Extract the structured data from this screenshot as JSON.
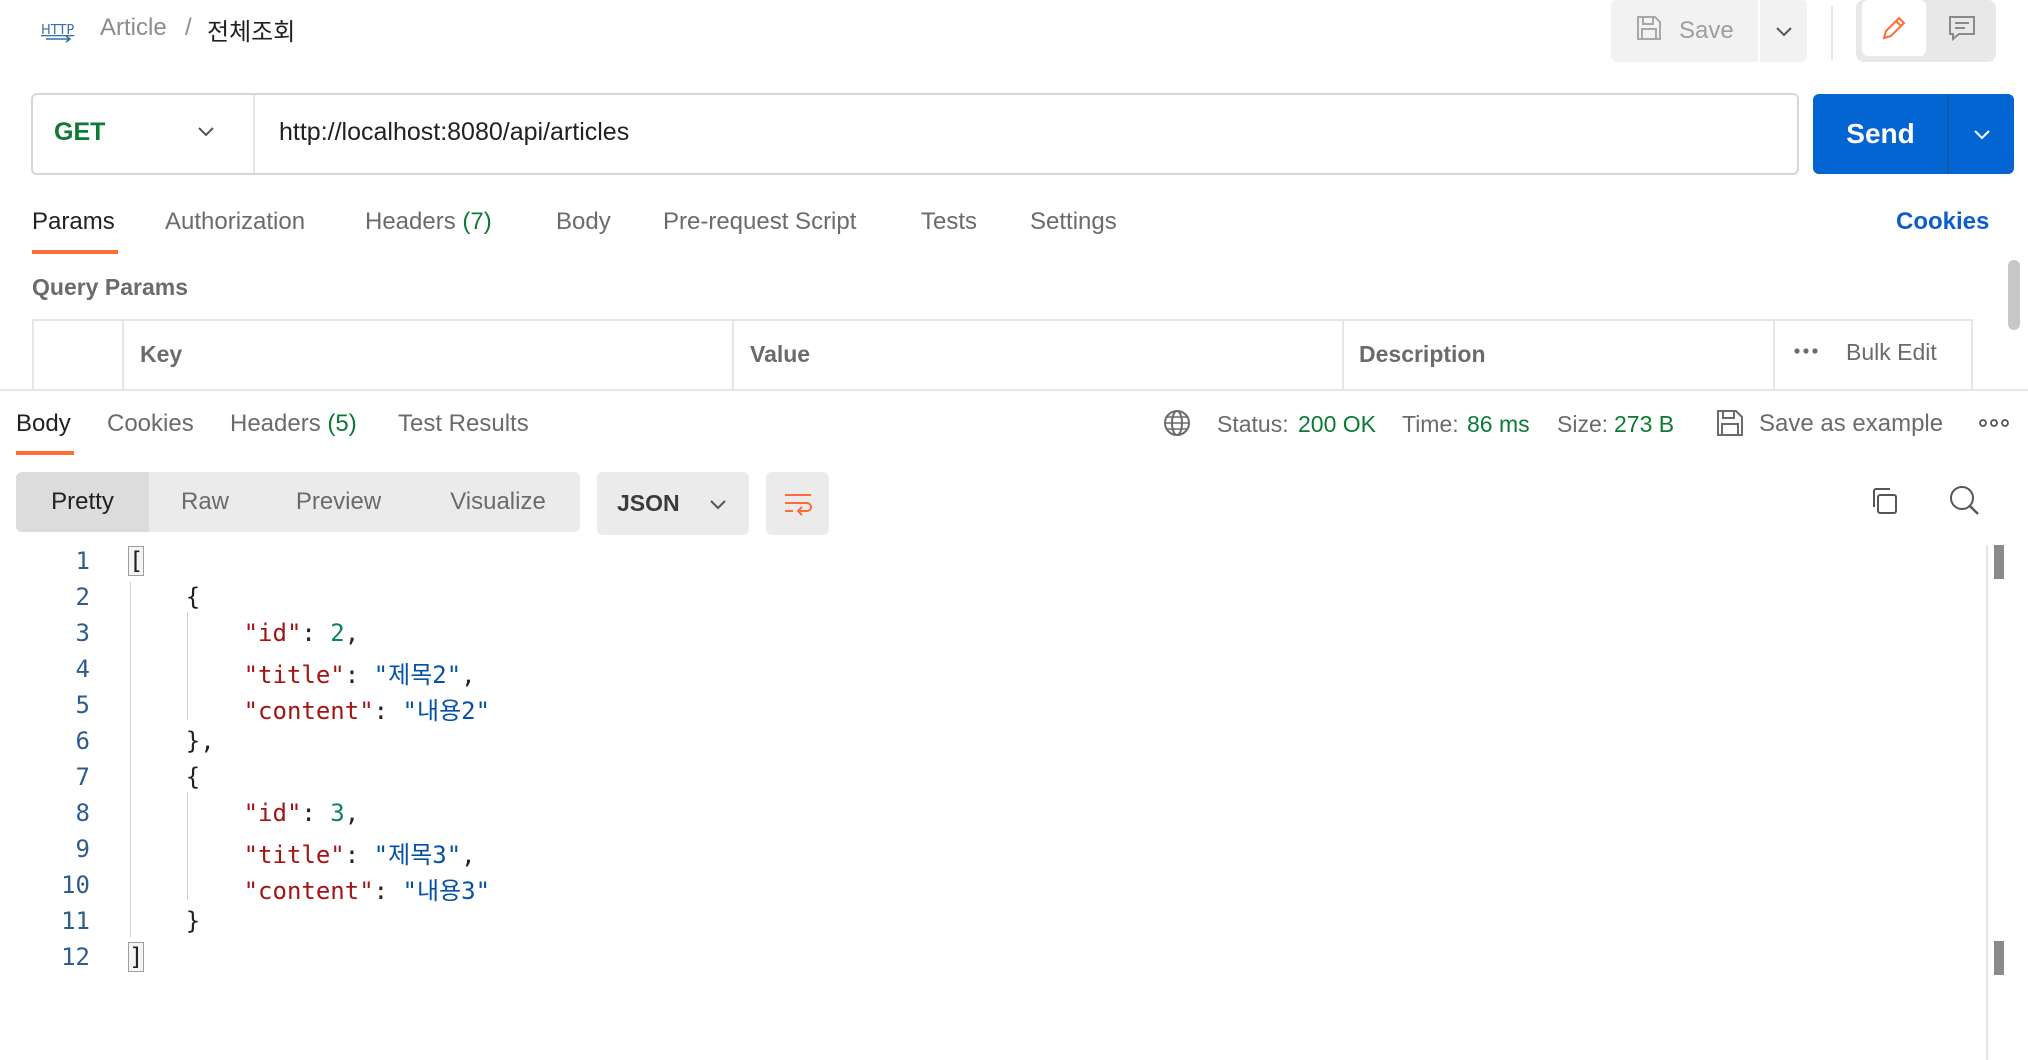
{
  "breadcrumb": {
    "icon": "http-icon",
    "parent": "Article",
    "separator": "/",
    "current": "전체조회"
  },
  "toolbar": {
    "save_label": "Save"
  },
  "request": {
    "method": "GET",
    "url": "http://localhost:8080/api/articles",
    "send_label": "Send",
    "tabs": [
      {
        "label": "Params",
        "active": true
      },
      {
        "label": "Authorization"
      },
      {
        "label": "Headers",
        "count": "(7)"
      },
      {
        "label": "Body"
      },
      {
        "label": "Pre-request Script"
      },
      {
        "label": "Tests"
      },
      {
        "label": "Settings"
      }
    ],
    "cookies_label": "Cookies",
    "query_params": {
      "title": "Query Params",
      "columns": [
        "Key",
        "Value",
        "Description"
      ],
      "bulk_edit_label": "Bulk Edit"
    }
  },
  "response": {
    "tabs": [
      {
        "label": "Body",
        "active": true
      },
      {
        "label": "Cookies"
      },
      {
        "label": "Headers",
        "count": "(5)"
      },
      {
        "label": "Test Results"
      }
    ],
    "status_label": "Status:",
    "status_value": "200 OK",
    "time_label": "Time:",
    "time_value": "86 ms",
    "size_label": "Size:",
    "size_value": "273 B",
    "save_example_label": "Save as example",
    "views": [
      "Pretty",
      "Raw",
      "Preview",
      "Visualize"
    ],
    "active_view": "Pretty",
    "format": "JSON",
    "line_numbers": [
      "1",
      "2",
      "3",
      "4",
      "5",
      "6",
      "7",
      "8",
      "9",
      "10",
      "11",
      "12"
    ],
    "body": [
      {
        "id": 2,
        "title": "제목2",
        "content": "내용2"
      },
      {
        "id": 3,
        "title": "제목3",
        "content": "내용3"
      }
    ]
  },
  "colors": {
    "accent": "#ff6c37",
    "send": "#0265d2",
    "success": "#0c7a34",
    "link": "#0b5ecc"
  }
}
